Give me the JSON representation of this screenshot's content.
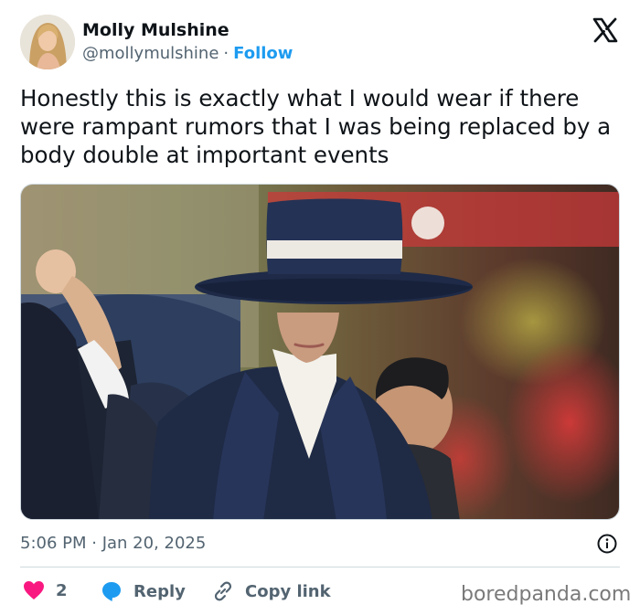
{
  "author": {
    "name": "Molly Mulshine",
    "handle": "@mollymulshine",
    "separator": "·",
    "follow_label": "Follow"
  },
  "tweet": {
    "text": "Honestly this is exactly what I would wear if there were rampant rumors that I was being replaced by a body double at important events",
    "timestamp": "5:06 PM · Jan 20, 2025"
  },
  "actions": {
    "like_count": "2",
    "reply_label": "Reply",
    "copy_link_label": "Copy link"
  },
  "watermark": "boredpanda.com",
  "icons": {
    "brand": "x-logo-icon",
    "info": "info-icon",
    "like": "heart-icon",
    "reply": "speech-bubble-icon",
    "copy": "link-icon"
  },
  "colors": {
    "follow": "#1d9bf0",
    "heart": "#f91880",
    "reply_bubble": "#1d9bf0",
    "muted": "#536471",
    "divider": "#cfd9de"
  }
}
